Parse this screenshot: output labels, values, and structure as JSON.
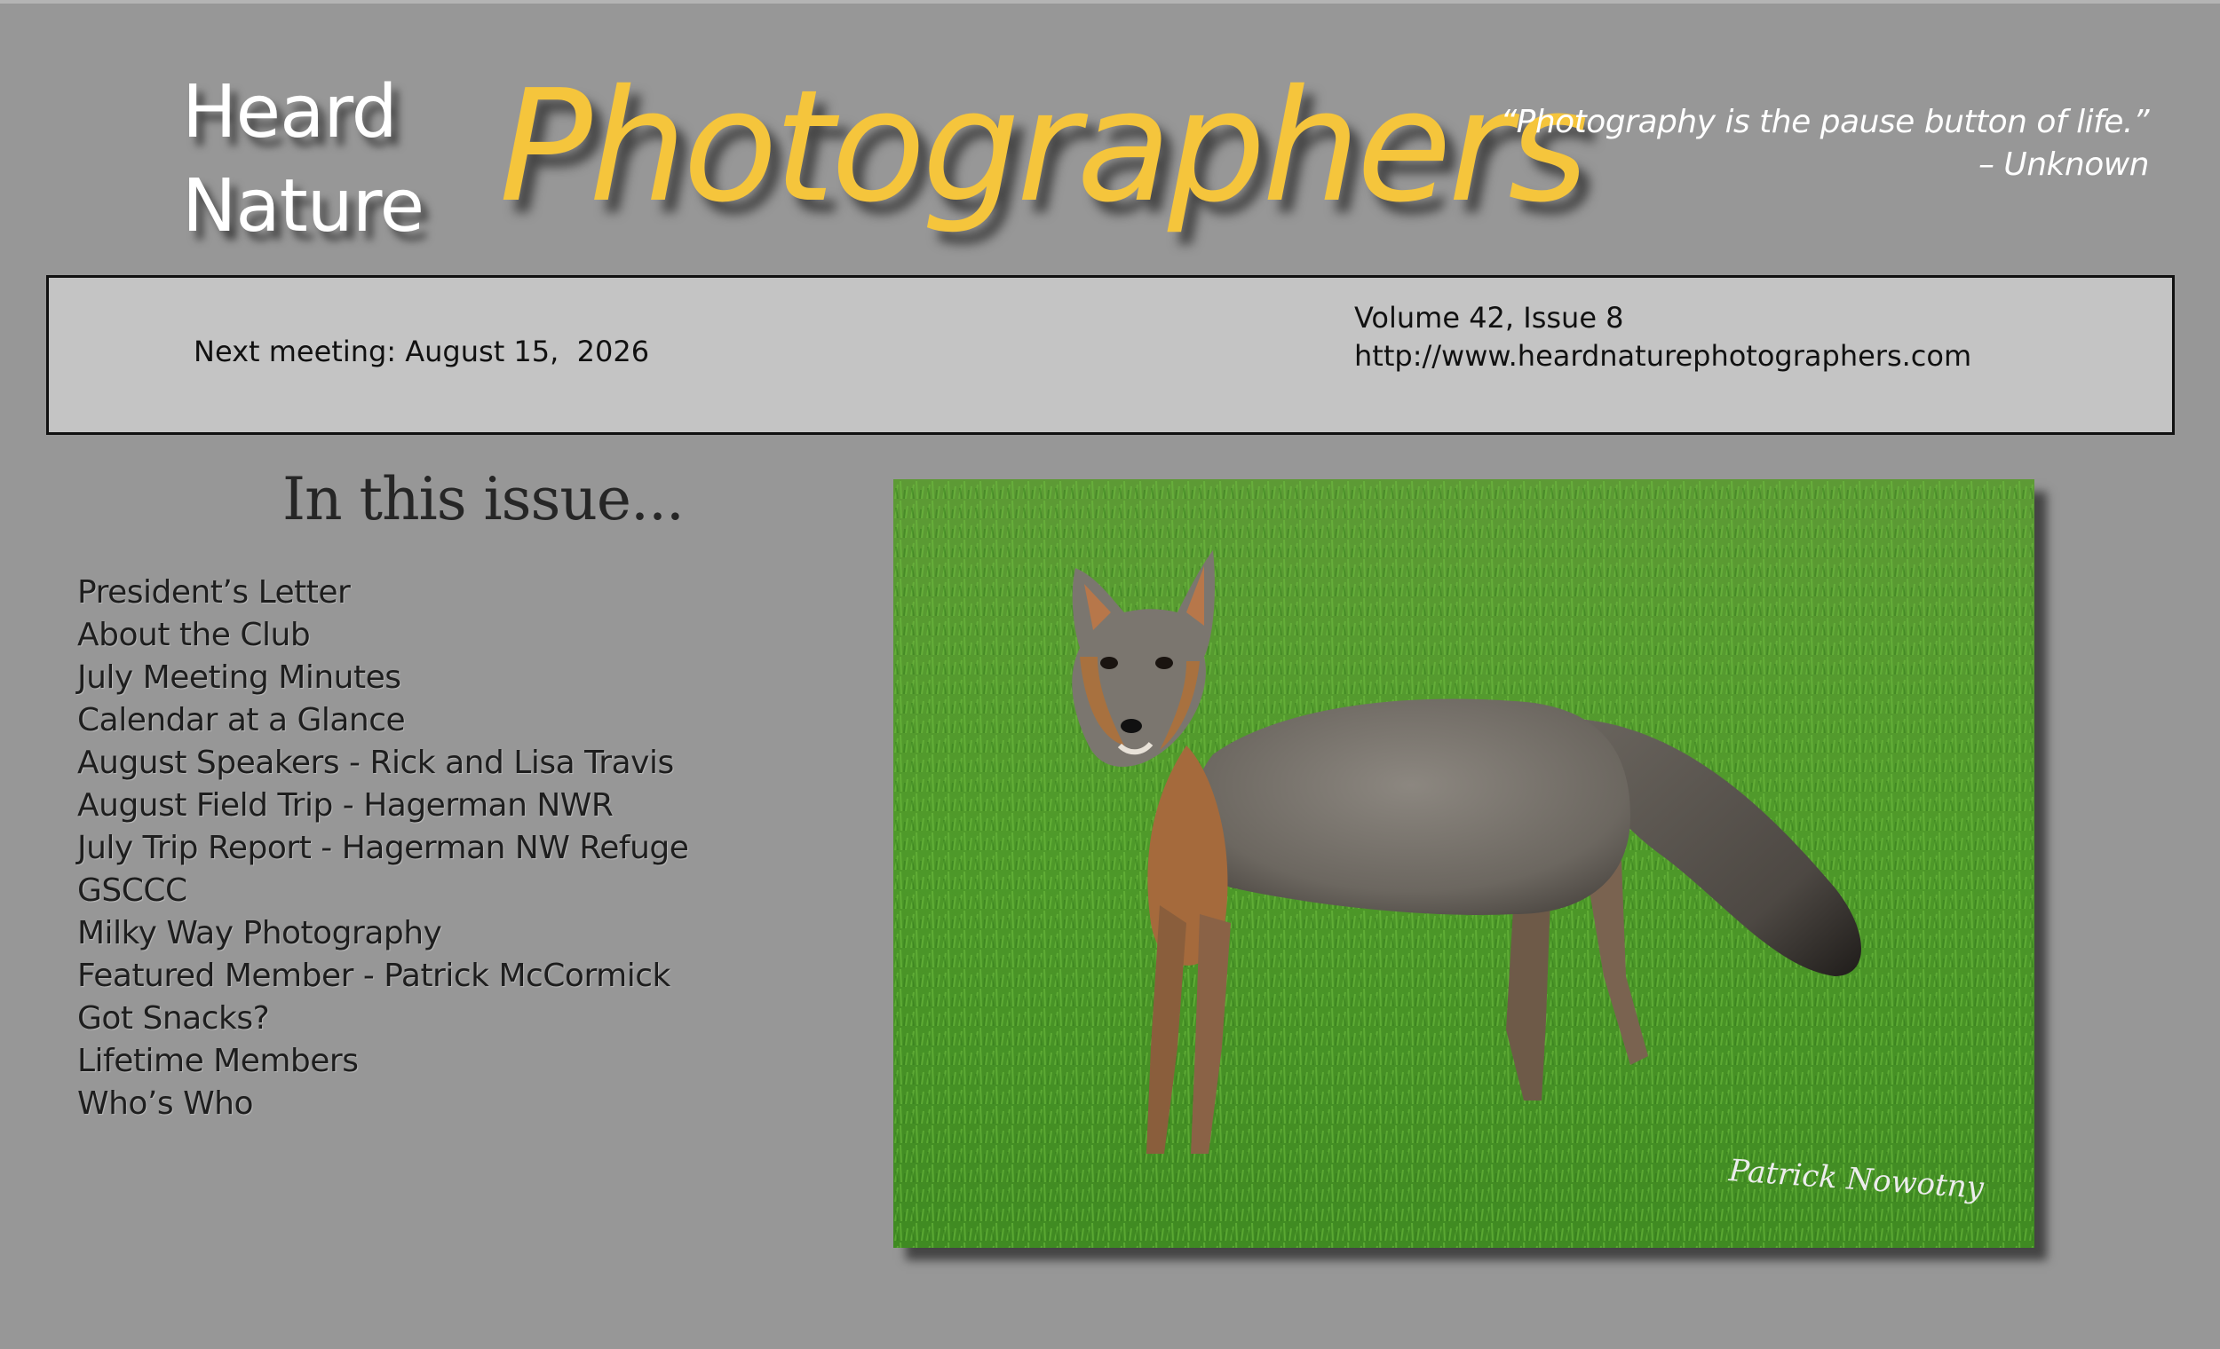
{
  "masthead": {
    "line1": "Heard",
    "line2": "Nature",
    "title": "Photographers",
    "title_color": "#f5c53c"
  },
  "quote": {
    "text": "“Photography is the pause button of life.”",
    "attribution": "– Unknown"
  },
  "info_bar": {
    "next_meeting": "Next meeting: August 15,  2026",
    "volume": "Volume 42, Issue 8",
    "website": "http://www.heardnaturephotographers.com"
  },
  "contents": {
    "heading": "In this issue...",
    "items": [
      "President’s Letter",
      "About the Club",
      "July Meeting Minutes",
      "Calendar at a Glance",
      "August Speakers - Rick and Lisa Travis",
      "August Field Trip - Hagerman NWR",
      "July Trip Report - Hagerman NW Refuge",
      "GSCCC",
      "Milky Way Photography",
      "Featured Member - Patrick McCormick",
      "Got Snacks?",
      "Lifetime Members",
      "Who’s Who"
    ]
  },
  "cover_photo": {
    "subject": "gray-fox-on-grass",
    "credit": "Patrick Nowotny"
  }
}
